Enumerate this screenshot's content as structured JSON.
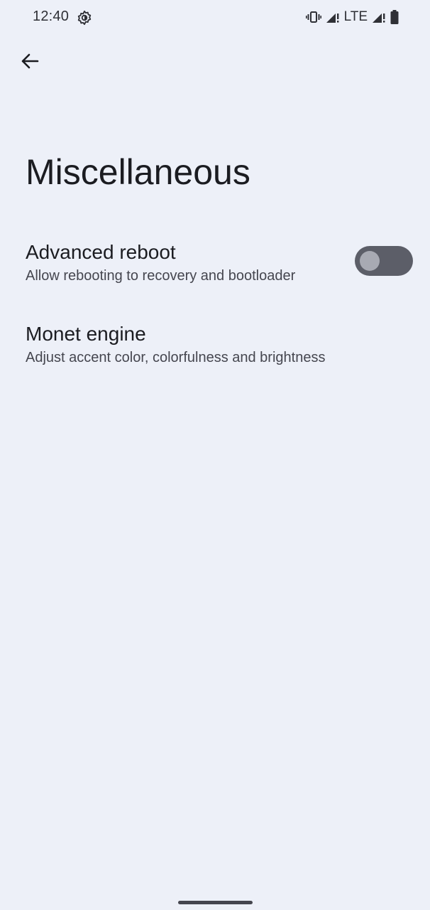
{
  "status_bar": {
    "time": "12:40",
    "network": "LTE",
    "icons": [
      "settings-gear-icon",
      "vibrate-icon",
      "signal-icon",
      "signal-icon",
      "battery-icon"
    ]
  },
  "header": {
    "back_icon": "arrow-back-icon",
    "title": "Miscellaneous"
  },
  "preferences": [
    {
      "title": "Advanced reboot",
      "summary": "Allow rebooting to recovery and bootloader",
      "toggle_on": false
    },
    {
      "title": "Monet engine",
      "summary": "Adjust accent color, colorfulness and brightness"
    }
  ],
  "colors": {
    "background": "#edf0f8",
    "toggle_track_off": "#5c5e68",
    "toggle_thumb_off": "#a8aab3"
  }
}
